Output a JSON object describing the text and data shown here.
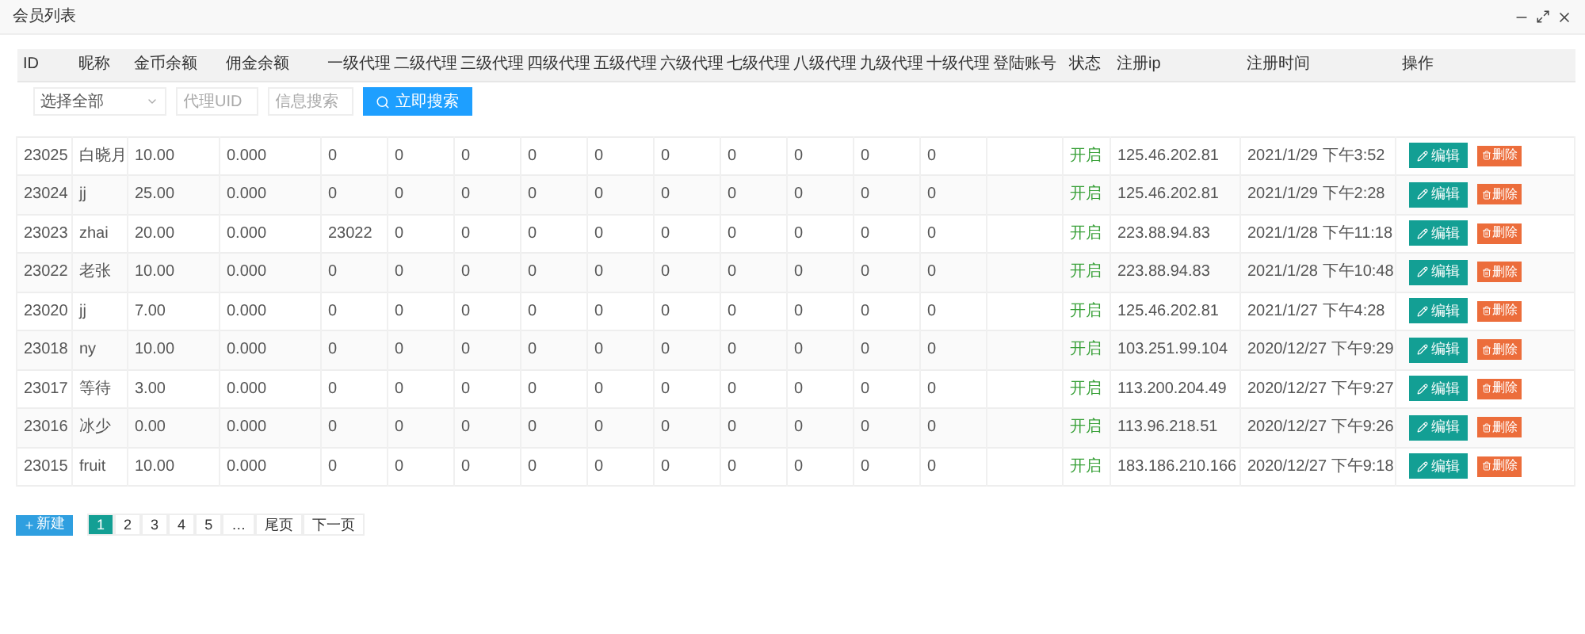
{
  "window": {
    "title": "会员列表"
  },
  "table": {
    "columns": [
      "ID",
      "昵称",
      "金币余额",
      "佣金余额",
      "一级代理",
      "二级代理",
      "三级代理",
      "四级代理",
      "五级代理",
      "六级代理",
      "七级代理",
      "八级代理",
      "九级代理",
      "十级代理",
      "登陆账号",
      "状态",
      "注册ip",
      "注册时间",
      "操作"
    ],
    "filter": {
      "select": "选择全部",
      "uid_placeholder": "代理UID",
      "search_placeholder": "信息搜索",
      "button": "立即搜索"
    },
    "rows": [
      {
        "cells": [
          "23025",
          "白晓月",
          "10.00",
          "0.000",
          "0",
          "0",
          "0",
          "0",
          "0",
          "0",
          "0",
          "0",
          "0",
          "0",
          "",
          "开启",
          "125.46.202.81",
          "2021/1/29 下午3:52"
        ],
        "edit": "编辑",
        "delete": "删除"
      },
      {
        "cells": [
          "23024",
          "jj",
          "25.00",
          "0.000",
          "0",
          "0",
          "0",
          "0",
          "0",
          "0",
          "0",
          "0",
          "0",
          "0",
          "",
          "开启",
          "125.46.202.81",
          "2021/1/29 下午2:28"
        ],
        "edit": "编辑",
        "delete": "删除"
      },
      {
        "cells": [
          "23023",
          "zhai",
          "20.00",
          "0.000",
          "23022",
          "0",
          "0",
          "0",
          "0",
          "0",
          "0",
          "0",
          "0",
          "0",
          "",
          "开启",
          "223.88.94.83",
          "2021/1/28 下午11:18"
        ],
        "edit": "编辑",
        "delete": "删除"
      },
      {
        "cells": [
          "23022",
          "老张",
          "10.00",
          "0.000",
          "0",
          "0",
          "0",
          "0",
          "0",
          "0",
          "0",
          "0",
          "0",
          "0",
          "",
          "开启",
          "223.88.94.83",
          "2021/1/28 下午10:48"
        ],
        "edit": "编辑",
        "delete": "删除"
      },
      {
        "cells": [
          "23020",
          "jj",
          "7.00",
          "0.000",
          "0",
          "0",
          "0",
          "0",
          "0",
          "0",
          "0",
          "0",
          "0",
          "0",
          "",
          "开启",
          "125.46.202.81",
          "2021/1/27 下午4:28"
        ],
        "edit": "编辑",
        "delete": "删除"
      },
      {
        "cells": [
          "23018",
          "ny",
          "10.00",
          "0.000",
          "0",
          "0",
          "0",
          "0",
          "0",
          "0",
          "0",
          "0",
          "0",
          "0",
          "",
          "开启",
          "103.251.99.104",
          "2020/12/27 下午9:29"
        ],
        "edit": "编辑",
        "delete": "删除"
      },
      {
        "cells": [
          "23017",
          "等待",
          "3.00",
          "0.000",
          "0",
          "0",
          "0",
          "0",
          "0",
          "0",
          "0",
          "0",
          "0",
          "0",
          "",
          "开启",
          "113.200.204.49",
          "2020/12/27 下午9:27"
        ],
        "edit": "编辑",
        "delete": "删除"
      },
      {
        "cells": [
          "23016",
          "冰少",
          "0.00",
          "0.000",
          "0",
          "0",
          "0",
          "0",
          "0",
          "0",
          "0",
          "0",
          "0",
          "0",
          "",
          "开启",
          "113.96.218.51",
          "2020/12/27 下午9:26"
        ],
        "edit": "编辑",
        "delete": "删除"
      },
      {
        "cells": [
          "23015",
          "fruit",
          "10.00",
          "0.000",
          "0",
          "0",
          "0",
          "0",
          "0",
          "0",
          "0",
          "0",
          "0",
          "0",
          "",
          "开启",
          "183.186.210.166",
          "2020/12/27 下午9:18"
        ],
        "edit": "编辑",
        "delete": "删除"
      }
    ]
  },
  "add_button": "新建",
  "pagination": [
    {
      "label": "1",
      "selected": true
    },
    {
      "label": "2",
      "selected": false
    },
    {
      "label": "3",
      "selected": false
    },
    {
      "label": "4",
      "selected": false
    },
    {
      "label": "5",
      "selected": false
    },
    {
      "label": "…",
      "selected": false
    },
    {
      "label": "尾页",
      "selected": false
    },
    {
      "label": "下一页",
      "selected": false
    }
  ]
}
